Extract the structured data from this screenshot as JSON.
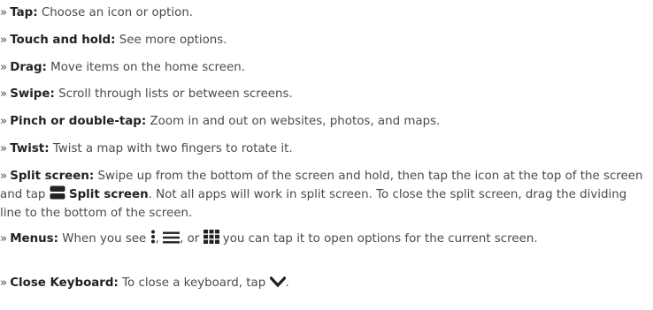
{
  "bullet_glyph": "»",
  "items": [
    {
      "term": "Tap:",
      "text": " Choose an icon or option."
    },
    {
      "term": "Touch and hold:",
      "text": " See more options."
    },
    {
      "term": "Drag:",
      "text": " Move items on the home screen."
    },
    {
      "term": "Swipe:",
      "text": " Scroll through lists or between screens."
    },
    {
      "term": "Pinch or double-tap:",
      "text": " Zoom in and out on websites, photos, and maps."
    },
    {
      "term": "Twist:",
      "text": " Twist a map with two fingers to rotate it."
    },
    {
      "term": "Split screen:",
      "text_before_icon": " Swipe up from the bottom of the screen and hold, then tap the icon at the top of the screen and tap ",
      "icon": "split-screen-icon",
      "bold_label": "Split screen",
      "text_after": ". Not all apps will work in split screen. To close the split screen, drag the dividing line to the bottom of the screen."
    },
    {
      "term": "Menus:",
      "text_part1": " When you see ",
      "icon1": "vertical-dots-menu-icon",
      "sep1": ", ",
      "icon2": "hamburger-menu-icon",
      "sep2": ", or ",
      "icon3": "grid-menu-icon",
      "text_part2": " you can tap it to open options for the current screen."
    },
    {
      "term": "Close Keyboard:",
      "text_before_icon": " To close a keyboard, tap ",
      "icon": "chevron-down-icon",
      "text_after": "."
    }
  ],
  "colors": {
    "text": "#4a4a4a",
    "term": "#222222"
  }
}
